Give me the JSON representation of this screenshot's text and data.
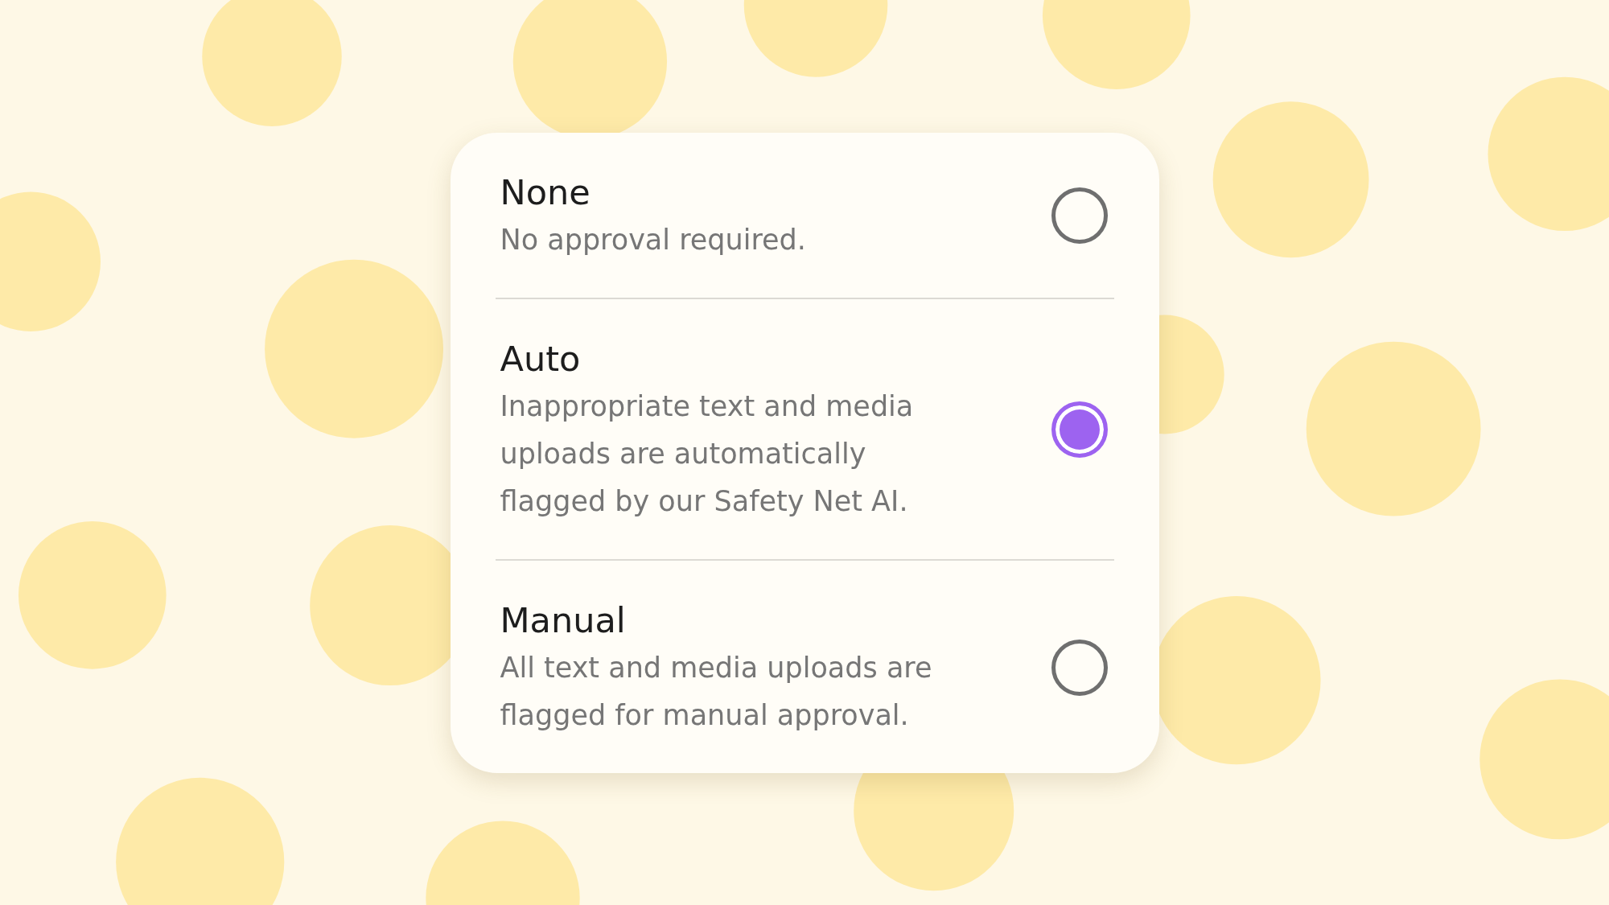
{
  "options": [
    {
      "title": "None",
      "description": "No approval required.",
      "selected": false
    },
    {
      "title": "Auto",
      "description": "Inappropriate text and media uploads are automatically flagged by our Safety Net AI.",
      "selected": true
    },
    {
      "title": "Manual",
      "description": "All text and media uploads are flagged for manual approval.",
      "selected": false
    }
  ]
}
